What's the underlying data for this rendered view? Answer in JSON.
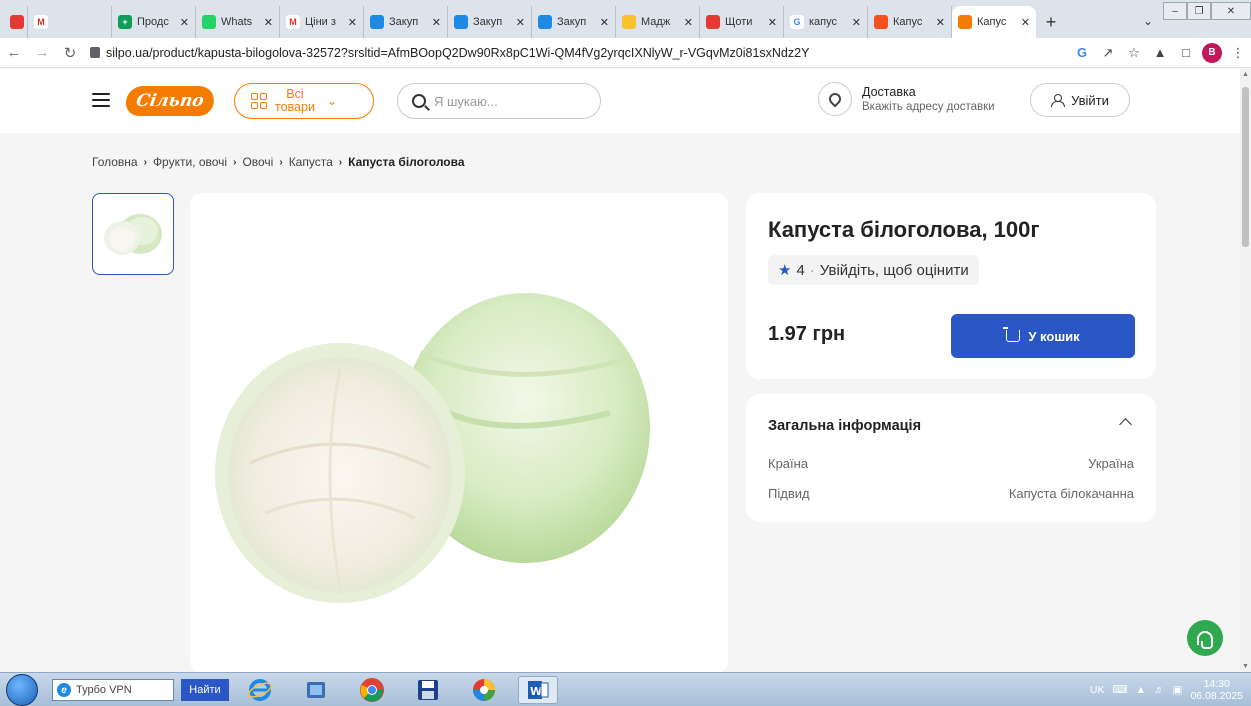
{
  "browser": {
    "tabs": [
      {
        "label": "",
        "fav_color": "#e53935",
        "fav_text": ""
      },
      {
        "label": "",
        "fav_color": "#ffffff",
        "fav_text": "M"
      },
      {
        "label": "Продс",
        "fav_color": "#0f9d58",
        "fav_text": "+"
      },
      {
        "label": "Whats",
        "fav_color": "#25d366",
        "fav_text": ""
      },
      {
        "label": "Ціни з",
        "fav_color": "#ffffff",
        "fav_text": "M"
      },
      {
        "label": "Закуп",
        "fav_color": "#1e88e5",
        "fav_text": ""
      },
      {
        "label": "Закуп",
        "fav_color": "#1e88e5",
        "fav_text": ""
      },
      {
        "label": "Закуп",
        "fav_color": "#1e88e5",
        "fav_text": ""
      },
      {
        "label": "Мадж",
        "fav_color": "#fbc02d",
        "fav_text": ""
      },
      {
        "label": "Щоти",
        "fav_color": "#e53935",
        "fav_text": ""
      },
      {
        "label": "капус",
        "fav_color": "#4285f4",
        "fav_text": "G"
      },
      {
        "label": "Капус",
        "fav_color": "#f4511e",
        "fav_text": ""
      },
      {
        "label": "Капус",
        "fav_color": "#f57c00",
        "fav_text": ""
      }
    ],
    "url": "silpo.ua/product/kapusta-bilogolova-32572?srsltid=AfmBOopQ2Dw90Rx8pC1Wi-QM4fVg2yrqcIXNlyW_r-VGqvMz0i81sxNdz2Y",
    "profile_letter": "B"
  },
  "header": {
    "logo_text": "Сільпо",
    "all_goods_line1": "Всі",
    "all_goods_line2": "товари",
    "search_placeholder": "Я шукаю...",
    "delivery_title": "Доставка",
    "delivery_subtitle": "Вкажіть адресу доставки",
    "login_label": "Увійти"
  },
  "breadcrumb": [
    "Головна",
    "Фрукти, овочі",
    "Овочі",
    "Капуста",
    "Капуста білоголова"
  ],
  "product": {
    "title": "Капуста білоголова, 100г",
    "rating": "4",
    "rate_prompt": "Увійдіть, щоб оцінити",
    "price": "1.97 грн",
    "cart_label": "У кошик",
    "accent_color": "#2a56c6"
  },
  "info": {
    "title": "Загальна інформація",
    "rows": [
      {
        "label": "Країна",
        "value": "Україна"
      },
      {
        "label": "Підвид",
        "value": "Капуста білокачанна"
      }
    ]
  },
  "taskbar": {
    "vpn_label": "Турбо VPN",
    "find_label": "Найти",
    "lang": "UK",
    "time": "14:30",
    "date": "06.08.2025"
  }
}
